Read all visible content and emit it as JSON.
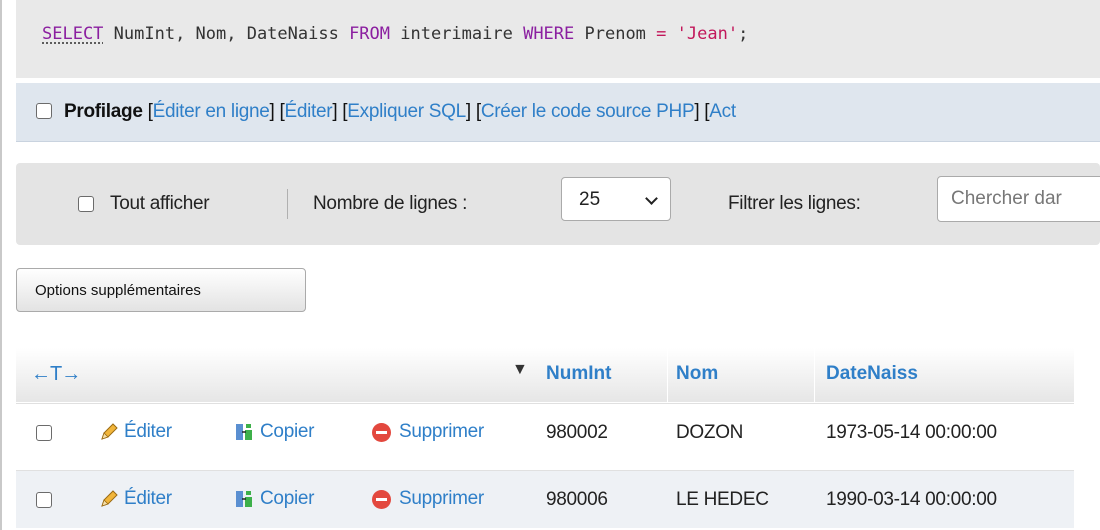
{
  "sql": {
    "select_kw": "SELECT",
    "columns": " NumInt, Nom, DateNaiss ",
    "from_kw": "FROM",
    "table": " interimaire ",
    "where_kw": "WHERE",
    "field": " Prenom ",
    "op": "=",
    "value": "'Jean'",
    "end": ";"
  },
  "profile": {
    "label": "Profilage",
    "links": [
      "Éditer en ligne",
      "Éditer",
      "Expliquer SQL",
      "Créer le code source PHP",
      "Act"
    ]
  },
  "nav": {
    "show_all": "Tout afficher",
    "rows_label": "Nombre de lignes :",
    "rows_value": "25",
    "filter_label": "Filtrer les lignes:",
    "search_placeholder": "Chercher dar"
  },
  "options_button": "Options supplémentaires",
  "table": {
    "arrows": "←T→",
    "columns": [
      "NumInt",
      "Nom",
      "DateNaiss"
    ],
    "actions": {
      "edit": "Éditer",
      "copy": "Copier",
      "delete": "Supprimer"
    },
    "rows": [
      {
        "numint": "980002",
        "nom": "DOZON",
        "datenaiss": "1973-05-14 00:00:00"
      },
      {
        "numint": "980006",
        "nom": "LE HEDEC",
        "datenaiss": "1990-03-14 00:00:00"
      }
    ]
  },
  "colors": {
    "link": "#2f7fc8",
    "keyword": "#8b1fa0",
    "string": "#c2185b",
    "delete": "#e3483e"
  }
}
